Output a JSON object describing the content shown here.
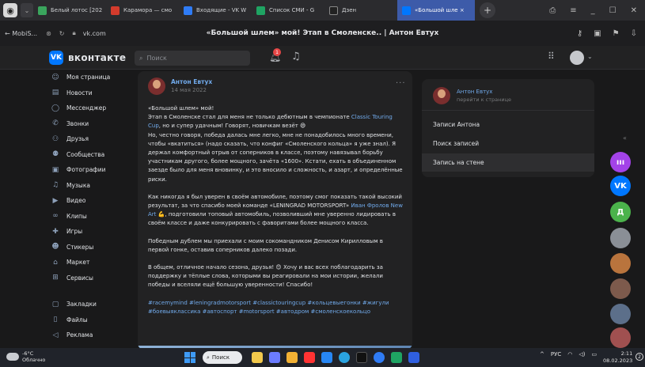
{
  "browser": {
    "tabs": [
      {
        "label": "Белый лотос [202",
        "color": "#3aa55d"
      },
      {
        "label": "Карамора — смо",
        "color": "#d33b2c"
      },
      {
        "label": "Входящие - VK W",
        "color": "#2f7cf6"
      },
      {
        "label": "Список СМИ - G",
        "color": "#1fa463"
      },
      {
        "label": "Дзен",
        "color": "#222222"
      },
      {
        "label": "«Большой шле ×",
        "color": "#0077ff"
      }
    ],
    "address": {
      "back_label": "← MobiS...",
      "url": "vk.com",
      "page_title": "«Большой шлем» мой! Этап в Смоленске.. | Антон Евтух"
    }
  },
  "vk": {
    "brand": "вконтакте",
    "logo_letters": "VK",
    "search_placeholder": "Поиск",
    "notifications_count": "1",
    "accent": "#0077ff"
  },
  "sidebar": {
    "items": [
      {
        "label": "Моя страница",
        "icon": "user-icon",
        "glyph": "☺"
      },
      {
        "label": "Новости",
        "icon": "news-icon",
        "glyph": "▤"
      },
      {
        "label": "Мессенджер",
        "icon": "message-icon",
        "glyph": "◯"
      },
      {
        "label": "Звонки",
        "icon": "phone-icon",
        "glyph": "✆"
      },
      {
        "label": "Друзья",
        "icon": "friends-icon",
        "glyph": "⚇"
      },
      {
        "label": "Сообщества",
        "icon": "community-icon",
        "glyph": "⚉"
      },
      {
        "label": "Фотографии",
        "icon": "photo-icon",
        "glyph": "▣"
      },
      {
        "label": "Музыка",
        "icon": "music-icon",
        "glyph": "♫"
      },
      {
        "label": "Видео",
        "icon": "video-icon",
        "glyph": "▶"
      },
      {
        "label": "Клипы",
        "icon": "clips-icon",
        "glyph": "∞"
      },
      {
        "label": "Игры",
        "icon": "games-icon",
        "glyph": "✚"
      },
      {
        "label": "Стикеры",
        "icon": "sticker-icon",
        "glyph": "☻"
      },
      {
        "label": "Маркет",
        "icon": "market-icon",
        "glyph": "⌂"
      },
      {
        "label": "Сервисы",
        "icon": "services-icon",
        "glyph": "⊞"
      }
    ],
    "items2": [
      {
        "label": "Закладки",
        "icon": "bookmark-icon",
        "glyph": "▢"
      },
      {
        "label": "Файлы",
        "icon": "file-icon",
        "glyph": "▯"
      },
      {
        "label": "Реклама",
        "icon": "ads-icon",
        "glyph": "◁"
      }
    ]
  },
  "post": {
    "author": "Антон Евтух",
    "date": "14 мая 2022",
    "p1_title": "«Большой шлем» мой!",
    "p1_a": "Этап в Смоленске стал для меня не только дебютным в чемпионате ",
    "p1_link": "Classic Touring Cup",
    "p1_b": ", но и супер удачным! Говорят, новичкам везёт 😄",
    "p1_c": "Но, честно говоря, победа далась мне легко, мне не понадобилось много времени, чтобы «вкатиться» (надо сказать, что конфиг «Смоленского кольца» я уже знал). Я держал комфортный отрыв от соперников в классе, поэтому навязывал борьбу участникам другого, более мощного, зачёта «1600». Кстати, ехать в объединенном заезде было для меня вновинку, и это вносило и сложность, и азарт, и определённые риски.",
    "p2_a": "Как никогда я был уверен в своём автомобиле, поэтому смог показать такой высокий результат, за что спасибо моей команде «LENINGRAD MOTORSPORT» ",
    "p2_link": "Иван Фролов New Art",
    "p2_b": " 💪, подготовили топовый автомобиль, позволивший мне уверенно лидировать в своём классе и даже конкурировать с фаворитами более мощного класса.",
    "p3": "Победным дублем мы приехали с моим сокомандником Денисом Кирилловым в первой гонке, оставив соперников далеко позади.",
    "p4": "В общем, отличное начало сезона, друзья! 😊 Хочу и вас всех поблагодарить за поддержку и тёплые слова, которыми вы реагировали на мои истории, желали победы и вселяли ещё большую уверенности! Спасибо!",
    "hashtags": "#racemymind #leningradmotorsport #classictouringcup #кольцевыегонки #жигули #боевыяклассика #автоспорт #motorsport #автодром #смоленскоекольцо"
  },
  "right_menu": {
    "name": "Антон Евтух",
    "subtitle": "перейти к странице",
    "items": [
      "Записи Антона",
      "Поиск записей",
      "Запись на стене"
    ]
  },
  "messenger_column": {
    "collapse_glyph": "«",
    "bubbles": [
      {
        "icon": "vk-music-icon",
        "color": "#a343e8",
        "glyph": "ııı"
      },
      {
        "icon": "vk-logo-icon",
        "color": "#0077ff",
        "glyph": "VK"
      },
      {
        "icon": "chat-avatar-icon",
        "color": "#4bb34b",
        "glyph": "Д"
      },
      {
        "icon": "chat-avatar-icon",
        "color": "#8a8f96",
        "glyph": ""
      },
      {
        "icon": "chat-avatar-icon",
        "color": "#b9743d",
        "glyph": ""
      },
      {
        "icon": "chat-avatar-icon",
        "color": "#7d5a4c",
        "glyph": ""
      },
      {
        "icon": "chat-avatar-icon",
        "color": "#5c6f8a",
        "glyph": ""
      },
      {
        "icon": "chat-avatar-icon",
        "color": "#a05050",
        "glyph": ""
      }
    ]
  },
  "taskbar": {
    "weather_temp": "-6°C",
    "weather_desc": "Облачно",
    "search_label": "Поиск",
    "lang": "РУС",
    "time": "2:11",
    "date": "08.02.2023",
    "apps": [
      {
        "icon": "explorer-icon",
        "color": "#f2c94c"
      },
      {
        "icon": "chat-app-icon",
        "color": "#6b7cff"
      },
      {
        "icon": "folder-icon",
        "color": "#f2b134"
      },
      {
        "icon": "yandex-icon",
        "color": "#ff3333"
      },
      {
        "icon": "vk-app-icon",
        "color": "#2787f5"
      },
      {
        "icon": "telegram-icon",
        "color": "#2aa3e0"
      },
      {
        "icon": "tiktok-icon",
        "color": "#111111"
      },
      {
        "icon": "chrome-icon",
        "color": "#2f7cf6"
      },
      {
        "icon": "sheets-icon",
        "color": "#1fa463"
      },
      {
        "icon": "docs-icon",
        "color": "#2f5fe0"
      }
    ]
  }
}
